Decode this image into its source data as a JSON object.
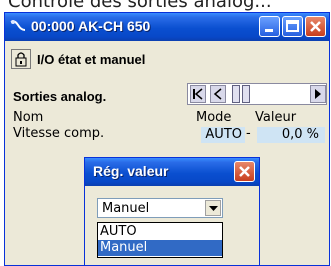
{
  "background_heading": "Contrôle des sorties analog...",
  "window": {
    "title": "00:000 AK-CH 650",
    "buttons": {
      "minimize": "minimize",
      "maximize": "maximize",
      "close": "close"
    }
  },
  "page": {
    "title": "I/O état et manuel"
  },
  "section": {
    "title": "Sorties analog."
  },
  "table": {
    "headers": {
      "name": "Nom",
      "mode": "Mode",
      "value": "Valeur"
    },
    "rows": [
      {
        "name": "Vitesse comp.",
        "mode": "AUTO",
        "separator": "-",
        "value": "0,0 %"
      }
    ]
  },
  "dialog": {
    "title": "Rég. valeur",
    "selected": "Manuel",
    "options": [
      "AUTO",
      "Manuel"
    ],
    "highlighted_option": "Manuel"
  },
  "colors": {
    "titlebar": "#0a4fd0",
    "window_bg": "#ece9d8",
    "cell_bg": "#cfe4f4",
    "selection": "#316ac5",
    "close_button": "#c83e1e"
  }
}
